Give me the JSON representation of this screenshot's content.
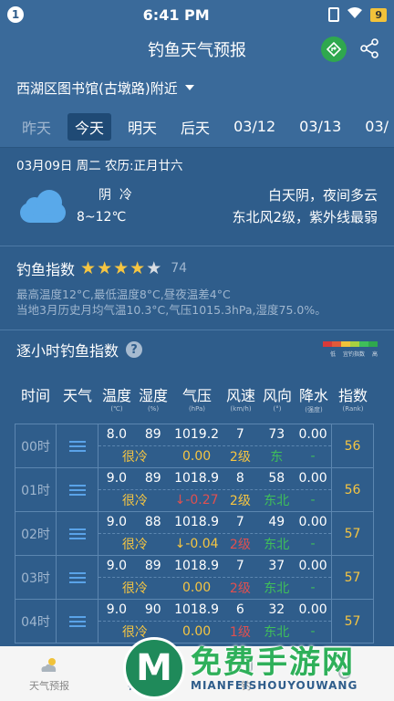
{
  "status": {
    "badge": "1",
    "time": "6:41 PM",
    "battery": "9"
  },
  "header": {
    "title": "钓鱼天气预报"
  },
  "location": {
    "name": "西湖区图书馆(古墩路)附近"
  },
  "day_tabs": [
    {
      "label": "昨天",
      "state": "past"
    },
    {
      "label": "今天",
      "state": "active"
    },
    {
      "label": "明天",
      "state": "normal"
    },
    {
      "label": "后天",
      "state": "normal"
    },
    {
      "label": "03/12",
      "state": "normal"
    },
    {
      "label": "03/13",
      "state": "normal"
    },
    {
      "label": "03/",
      "state": "normal"
    }
  ],
  "today": {
    "date_line": "03月09日 周二 农历:正月廿六",
    "condition": "阴  冷",
    "temp_range": "8~12℃",
    "summary1": "白天阴，夜间多云",
    "summary2": "东北风2级，紫外线最弱"
  },
  "fishing_index": {
    "title": "钓鱼指数",
    "stars_filled": 4,
    "stars_total": 5,
    "score": "74",
    "info1": "最高温度12°C,最低温度8°C,昼夜温差4°C",
    "info2": "当地3月历史月均气温10.3°C,气压1015.3hPa,湿度75.0%。"
  },
  "hourly": {
    "title": "逐小时钓鱼指数",
    "legend": {
      "low": "低",
      "mid": "宜钓指数",
      "high": "高",
      "colors": [
        "#d83a3a",
        "#e05a3a",
        "#f0c23a",
        "#a8d040",
        "#3fbf5a",
        "#2fa84e"
      ]
    },
    "headers": [
      "时间",
      "天气",
      "温度",
      "湿度",
      "气压",
      "风速",
      "风向",
      "降水",
      "指数"
    ],
    "units": [
      "",
      "",
      "(℃)",
      "(%)",
      "(hPa)",
      "(km/h)",
      "(°)",
      "(强度)",
      "(Rank)"
    ],
    "rows": [
      {
        "time": "00时",
        "temp": "8.0",
        "hum": "89",
        "pres": "1019.2",
        "wind": "7",
        "dir": "73",
        "rain": "0.00",
        "feel": "很冷",
        "pchg": "0.00",
        "level": "2级",
        "level_color": "yellow",
        "dirtxt": "东",
        "rtxt": "-",
        "rank": "56"
      },
      {
        "time": "01时",
        "temp": "9.0",
        "hum": "89",
        "pres": "1018.9",
        "wind": "8",
        "dir": "58",
        "rain": "0.00",
        "feel": "很冷",
        "pchg": "↓-0.27",
        "pchg_color": "red",
        "level": "2级",
        "level_color": "yellow",
        "dirtxt": "东北",
        "rtxt": "-",
        "rank": "56"
      },
      {
        "time": "02时",
        "temp": "9.0",
        "hum": "88",
        "pres": "1018.9",
        "wind": "7",
        "dir": "49",
        "rain": "0.00",
        "feel": "很冷",
        "pchg": "↓-0.04",
        "level": "2级",
        "level_color": "red",
        "dirtxt": "东北",
        "rtxt": "-",
        "rank": "57"
      },
      {
        "time": "03时",
        "temp": "9.0",
        "hum": "89",
        "pres": "1018.9",
        "wind": "7",
        "dir": "37",
        "rain": "0.00",
        "feel": "很冷",
        "pchg": "0.00",
        "level": "2级",
        "level_color": "red",
        "dirtxt": "东北",
        "rtxt": "-",
        "rank": "57"
      },
      {
        "time": "04时",
        "temp": "9.0",
        "hum": "90",
        "pres": "1018.9",
        "wind": "6",
        "dir": "32",
        "rain": "0.00",
        "feel": "很冷",
        "pchg": "0.00",
        "level": "1级",
        "level_color": "red",
        "dirtxt": "东北",
        "rtxt": "-",
        "rank": "57"
      }
    ]
  },
  "bottom_nav": [
    {
      "label": "天气预报",
      "active": false
    },
    {
      "label": "钓鱼指数",
      "active": true
    },
    {
      "label": "钓",
      "active": false
    },
    {
      "label": "",
      "active": false
    }
  ],
  "watermark": {
    "logo": "M",
    "text": "免费手游网",
    "sub": "MIANFEISHOUYOUWANG"
  }
}
